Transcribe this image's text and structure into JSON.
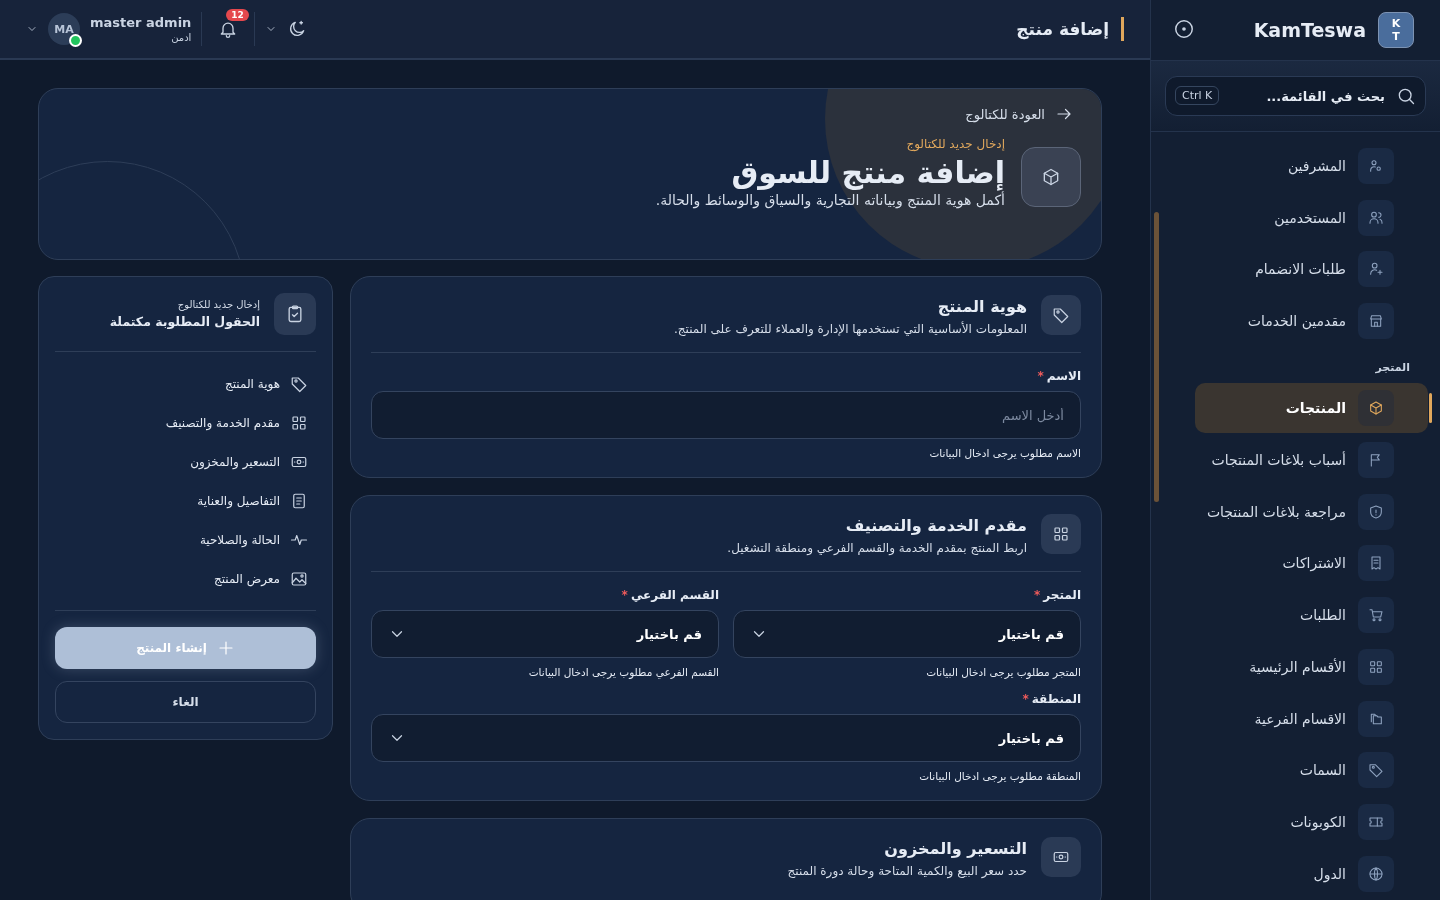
{
  "sidebar": {
    "brand": "KamTeswa",
    "logo": [
      "K",
      "T"
    ],
    "search": {
      "placeholder": "بحث في القائمة...",
      "shortcut": "Ctrl K"
    },
    "groups": [
      {
        "items": [
          {
            "label": "المشرفين",
            "selected": false
          },
          {
            "label": "المستخدمين",
            "selected": false
          },
          {
            "label": "طلبات الانضمام",
            "selected": false
          },
          {
            "label": "مقدمين الخدمات",
            "selected": false
          }
        ]
      },
      {
        "title": "المتجر",
        "items": [
          {
            "label": "المنتجات",
            "selected": true
          },
          {
            "label": "أسباب بلاغات المنتجات",
            "selected": false
          },
          {
            "label": "مراجعة بلاغات المنتجات",
            "selected": false
          },
          {
            "label": "الاشتراكات",
            "selected": false
          },
          {
            "label": "الطلبات",
            "selected": false
          },
          {
            "label": "الأقسام الرئيسية",
            "selected": false
          },
          {
            "label": "الاقسام الفرعية",
            "selected": false
          },
          {
            "label": "السمات",
            "selected": false
          },
          {
            "label": "الكوبونات",
            "selected": false
          },
          {
            "label": "الدول",
            "selected": false
          }
        ]
      }
    ]
  },
  "topbar": {
    "title": "إضافة منتج",
    "notifications": "12",
    "user": {
      "name": "master admin",
      "role": "ادمن",
      "initials": "MA",
      "online": true
    }
  },
  "hero": {
    "back_link": "العودة للكتالوج",
    "eyebrow": "إدخال جديد للكتالوج",
    "title": "إضافة منتج للسوق",
    "subtitle": "أكمل هوية المنتج وبياناته التجارية والسياق والوسائط والحالة."
  },
  "sections": [
    {
      "title": "هوية المنتج",
      "subtitle": "المعلومات الأساسية التي تستخدمها الإدارة والعملاء للتعرف على المنتج.",
      "rows": [
        [
          {
            "kind": "text",
            "label": "الاسم",
            "required_mark": "*",
            "placeholder": "أدخل الاسم",
            "error": "الاسم مطلوب يرجى ادخال البيانات"
          }
        ]
      ]
    },
    {
      "title": "مقدم الخدمة والتصنيف",
      "subtitle": "اربط المنتج بمقدم الخدمة والقسم الفرعي ومنطقة التشغيل.",
      "rows": [
        [
          {
            "kind": "select",
            "label": "المتجر",
            "required_mark": "*",
            "value": "قم باختيار",
            "error": "المتجر مطلوب يرجى ادخال البيانات"
          },
          {
            "kind": "select",
            "label": "القسم الفرعي",
            "required_mark": "*",
            "value": "قم باختيار",
            "error": "القسم الفرعي مطلوب يرجى ادخال البيانات"
          }
        ],
        [
          {
            "kind": "select",
            "label": "المنطقة",
            "required_mark": "*",
            "value": "قم باختيار",
            "error": "المنطقة مطلوب يرجى ادخال البيانات"
          }
        ]
      ]
    },
    {
      "title": "التسعير والمخزون",
      "subtitle": "حدد سعر البيع والكمية المتاحة وحالة دورة المنتج"
    }
  ],
  "summary": {
    "eyebrow": "إدخال جديد للكتالوج",
    "status": "الحقول المطلوبة مكتملة",
    "steps": [
      "هوية المنتج",
      "مقدم الخدمة والتصنيف",
      "التسعير والمخزون",
      "التفاصيل والعناية",
      "الحالة والصلاحية",
      "معرض المنتج"
    ],
    "submit": {
      "label": "إنشاء المنتج",
      "disabled": true
    },
    "cancel": "الغاء"
  }
}
